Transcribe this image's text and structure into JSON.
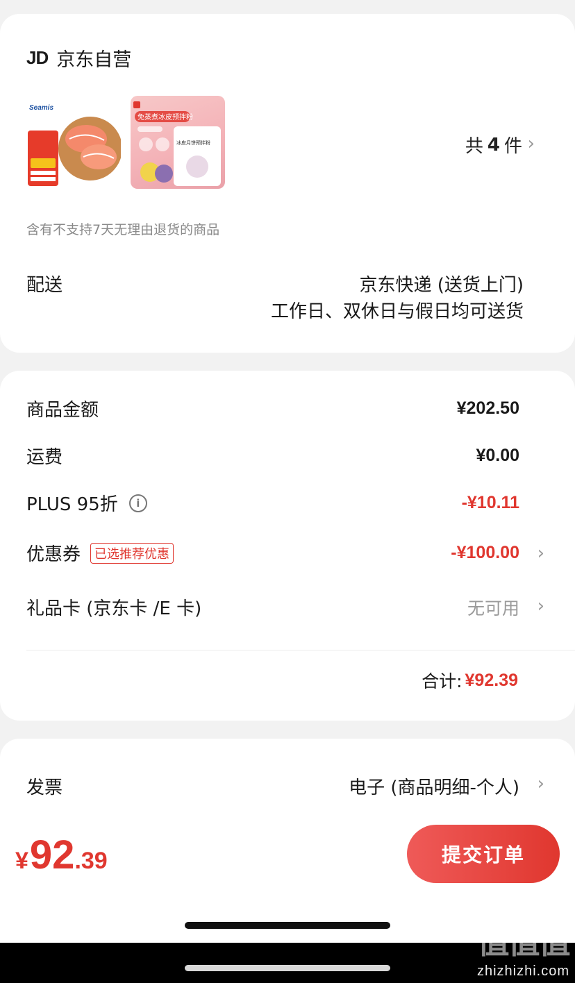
{
  "store": {
    "logo": "JD",
    "name": "京东自营"
  },
  "products": {
    "item1_image": "salmon-product-image",
    "item2_image": "snowskin-mooncake-mix-image",
    "item2_banner": "免蒸煮冰皮预拌粉",
    "item2_pack": "冰皮月饼预拌粉",
    "count_prefix": "共",
    "count": "4",
    "count_suffix": "件"
  },
  "note": "含有不支持7天无理由退货的商品",
  "delivery": {
    "label": "配送",
    "method": "京东快递 (送货上门)",
    "schedule": "工作日、双休日与假日均可送货"
  },
  "pricing": {
    "goods_label": "商品金额",
    "goods_value": "¥202.50",
    "shipping_label": "运费",
    "shipping_value": "¥0.00",
    "plus_label": "PLUS 95折",
    "plus_value": "-¥10.11",
    "coupon_label": "优惠券",
    "coupon_tag": "已选推荐优惠",
    "coupon_value": "-¥100.00",
    "giftcard_label": "礼品卡 (京东卡 /E 卡)",
    "giftcard_value": "无可用",
    "total_label": "合计:",
    "total_value": "¥92.39"
  },
  "invoice": {
    "label": "发票",
    "value": "电子 (商品明细-个人)"
  },
  "bottom": {
    "yen": "¥",
    "price_int": "92",
    "price_dec": ".39",
    "submit_label": "提交订单"
  },
  "watermark": {
    "mark": "值值值",
    "site": "zhizhizhi.com"
  },
  "colors": {
    "accent": "#e0372f",
    "background": "#f2f2f2"
  }
}
